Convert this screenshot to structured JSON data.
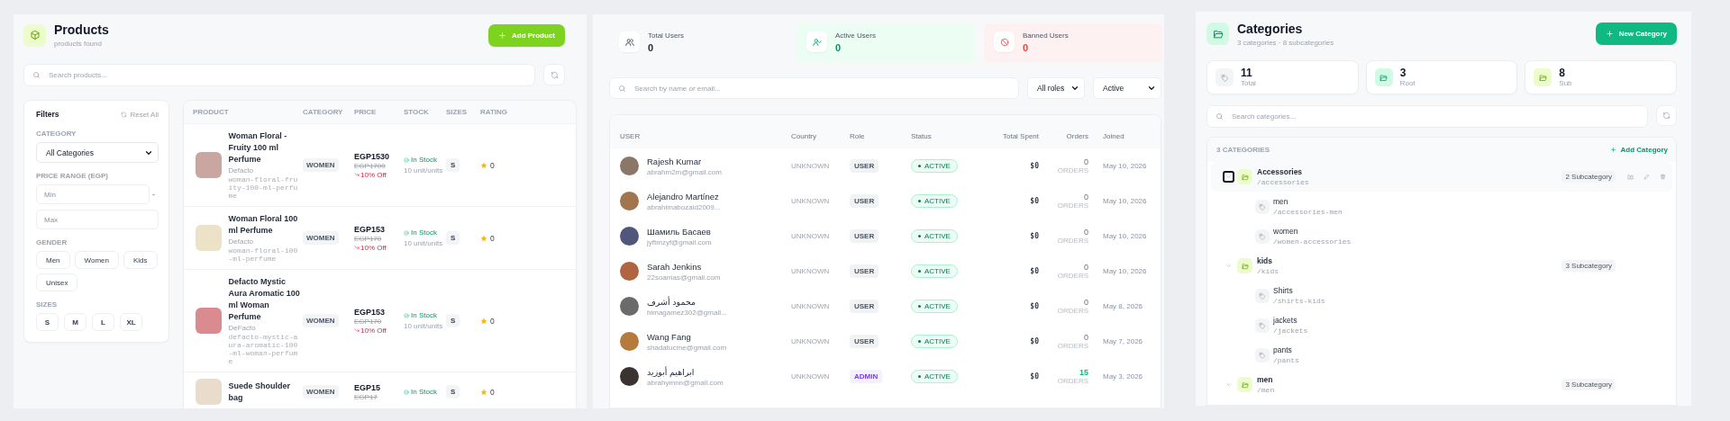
{
  "products": {
    "title": "Products",
    "subtitle": "products found",
    "add_button": "Add Product",
    "search": {
      "placeholder": "Search products..."
    },
    "filters": {
      "title": "Filters",
      "reset": "Reset All",
      "category": {
        "label": "CATEGORY",
        "value": "All Categories"
      },
      "price_range": {
        "label": "PRICE RANGE (EGP)",
        "min_placeholder": "Min",
        "separator": "-",
        "max_placeholder": "Max"
      },
      "gender": {
        "label": "GENDER",
        "options": [
          {
            "label": "Men",
            "selected": false
          },
          {
            "label": "Women",
            "selected": false
          },
          {
            "label": "Kids",
            "selected": false
          },
          {
            "label": "Unisex",
            "selected": false
          }
        ]
      },
      "sizes": {
        "label": "SIZES",
        "options": [
          {
            "label": "S",
            "selected": false
          },
          {
            "label": "M",
            "selected": false
          },
          {
            "label": "L",
            "selected": false
          },
          {
            "label": "XL",
            "selected": false
          }
        ]
      }
    },
    "table": {
      "columns": [
        "PRODUCT",
        "CATEGORY",
        "PRICE",
        "STOCK",
        "SIZES",
        "RATING"
      ],
      "rows": [
        {
          "name": "Woman Floral - Fruity 100 ml Perfume",
          "brand": "Defacto",
          "slug": "woman-floral-fruity-100-ml-perfume",
          "category": "WOMEN",
          "price": "EGP1530",
          "old_price": "EGP1700",
          "discount": "10% Off",
          "stock": "In Stock",
          "units": "10 unit/units",
          "sizes": [
            "S"
          ],
          "rating": "0"
        },
        {
          "name": "Woman Floral 100 ml Perfume",
          "brand": "Defacto",
          "slug": "woman-floral-100-ml-perfume",
          "category": "WOMEN",
          "price": "EGP153",
          "old_price": "EGP170",
          "discount": "10% Off",
          "stock": "In Stock",
          "units": "10 unit/units",
          "sizes": [
            "S"
          ],
          "rating": "0"
        },
        {
          "name": "Defacto Mystic Aura Aromatic 100 ml Woman Perfume",
          "brand": "DeFacto",
          "slug": "defacto-mystic-aura-aromatic-100-ml-woman-perfume",
          "category": "WOMEN",
          "price": "EGP153",
          "old_price": "EGP170",
          "discount": "10% Off",
          "stock": "In Stock",
          "units": "10 unit/units",
          "sizes": [
            "S"
          ],
          "rating": "0"
        },
        {
          "name": "Suede Shoulder bag",
          "category": "WOMEN",
          "price": "EGP15",
          "old_price": "EGP17",
          "stock": "In Stock",
          "sizes": [
            "S"
          ],
          "rating": "0"
        }
      ]
    }
  },
  "users": {
    "stats": [
      {
        "kind": "total",
        "label": "Total Users",
        "value": "0"
      },
      {
        "kind": "active",
        "label": "Active Users",
        "value": "0"
      },
      {
        "kind": "banned",
        "label": "Banned Users",
        "value": "0"
      }
    ],
    "search": {
      "placeholder": "Search by name or email..."
    },
    "role_filter": "All roles",
    "status_filter": "Active",
    "table": {
      "columns": [
        "USER",
        "Country",
        "Role",
        "Status",
        "Total Spent",
        "Orders",
        "Joined"
      ],
      "rows": [
        {
          "name": "Rajesh Kumar",
          "email": "abrahm2m@gmail.com",
          "country": "UNKNOWN",
          "role": {
            "label": "USER",
            "color": "#4b5563"
          },
          "status": "ACTIVE",
          "spent": "$0",
          "orders": "0",
          "orders_label": "ORDERS",
          "orders_highlight": false,
          "joined": "May 10, 2026"
        },
        {
          "name": "Alejandro Martínez",
          "email": "abrahimabozaid2009...",
          "country": "UNKNOWN",
          "role": {
            "label": "USER",
            "color": "#4b5563"
          },
          "status": "ACTIVE",
          "spent": "$0",
          "orders": "0",
          "orders_label": "ORDERS",
          "orders_highlight": false,
          "joined": "May 10, 2026"
        },
        {
          "name": "Шамиль Басаев",
          "email": "jyftmzyf@gmail.com",
          "country": "UNKNOWN",
          "role": {
            "label": "USER",
            "color": "#4b5563"
          },
          "status": "ACTIVE",
          "spent": "$0",
          "orders": "0",
          "orders_label": "ORDERS",
          "orders_highlight": false,
          "joined": "May 10, 2026"
        },
        {
          "name": "Sarah Jenkins",
          "email": "22soamas@gmail.com",
          "country": "UNKNOWN",
          "role": {
            "label": "USER",
            "color": "#4b5563"
          },
          "status": "ACTIVE",
          "spent": "$0",
          "orders": "0",
          "orders_label": "ORDERS",
          "orders_highlight": false,
          "joined": "May 10, 2026"
        },
        {
          "name": "محمود أشرف",
          "email": "himagamez302@gmail...",
          "country": "UNKNOWN",
          "role": {
            "label": "USER",
            "color": "#4b5563"
          },
          "status": "ACTIVE",
          "spent": "$0",
          "orders": "0",
          "orders_label": "ORDERS",
          "orders_highlight": false,
          "joined": "May 8, 2026"
        },
        {
          "name": "Wang Fang",
          "email": "shadatucme@gmail.com",
          "country": "UNKNOWN",
          "role": {
            "label": "USER",
            "color": "#4b5563"
          },
          "status": "ACTIVE",
          "spent": "$0",
          "orders": "0",
          "orders_label": "ORDERS",
          "orders_highlight": false,
          "joined": "May 7, 2026"
        },
        {
          "name": "ابراهيم أبوزيد",
          "email": "abrahymnn@gmail.com",
          "country": "UNKNOWN",
          "role": {
            "label": "ADMIN",
            "color": "#7c3aed"
          },
          "status": "ACTIVE",
          "spent": "$0",
          "orders": "15",
          "orders_label": "ORDERS",
          "orders_highlight": true,
          "joined": "May 3, 2026"
        }
      ]
    }
  },
  "categories": {
    "title": "Categories",
    "subtitle": "3 categories · 8 subcategories",
    "new_button": "New Category",
    "stats": [
      {
        "kind": "total",
        "value": "11",
        "label": "Total"
      },
      {
        "kind": "root",
        "value": "3",
        "label": "Root"
      },
      {
        "kind": "sub",
        "value": "8",
        "label": "Sub"
      }
    ],
    "search": {
      "placeholder": "Search categories..."
    },
    "list_title": "3 CATEGORIES",
    "add_link": "Add Category",
    "items": [
      {
        "name": "Accessories",
        "slug": "/accessories",
        "badge": "2 Subcategory",
        "expanded": true,
        "selected": true,
        "children": [
          {
            "name": "men",
            "slug": "/accessories-men"
          },
          {
            "name": "women",
            "slug": "/women-accessories"
          }
        ]
      },
      {
        "name": "kids",
        "slug": "/kids",
        "badge": "3 Subcategory",
        "expanded": true,
        "selected": false,
        "children": [
          {
            "name": "Shirts",
            "slug": "/shirts-kids"
          },
          {
            "name": "jackets",
            "slug": "/jackets"
          },
          {
            "name": "pants",
            "slug": "/pants"
          }
        ]
      },
      {
        "name": "men",
        "slug": "/men",
        "badge": "3 Subcategory",
        "expanded": true,
        "selected": false
      }
    ]
  }
}
